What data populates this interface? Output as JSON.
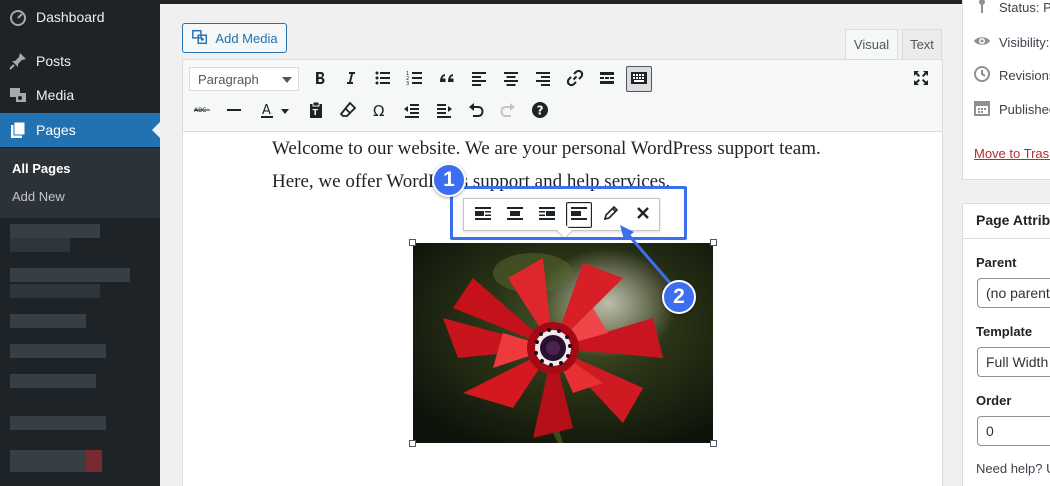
{
  "sidebar": {
    "items": [
      {
        "label": "Dashboard",
        "icon": "dashboard-icon"
      },
      {
        "label": "Posts",
        "icon": "pin-icon"
      },
      {
        "label": "Media",
        "icon": "media-icon"
      },
      {
        "label": "Pages",
        "icon": "pages-icon"
      }
    ],
    "submenu": [
      {
        "label": "All Pages"
      },
      {
        "label": "Add New"
      }
    ]
  },
  "editor": {
    "add_media_label": "Add Media",
    "tabs": [
      {
        "label": "Visual"
      },
      {
        "label": "Text"
      }
    ],
    "format_select_value": "Paragraph",
    "content": "Welcome to our website. We are your personal WordPress support team. Here, we offer WordPress support and help services."
  },
  "annotations": {
    "callout_1": "1",
    "callout_2": "2",
    "accent_color": "#3c6ff0"
  },
  "publish_box": {
    "status": "Status: P",
    "visibility": "Visibility:",
    "revisions": "Revisions",
    "published": "Published",
    "trash_link": "Move to Trash"
  },
  "page_attributes": {
    "title": "Page Attribu",
    "parent_label": "Parent",
    "parent_value": "(no parent",
    "template_label": "Template",
    "template_value": "Full Width",
    "order_label": "Order",
    "order_value": "0",
    "help_text": "Need help? U"
  },
  "colors": {
    "sidebar_bg": "#1d2327",
    "active_blue": "#2271b1",
    "trash_red": "#b32d2e"
  }
}
